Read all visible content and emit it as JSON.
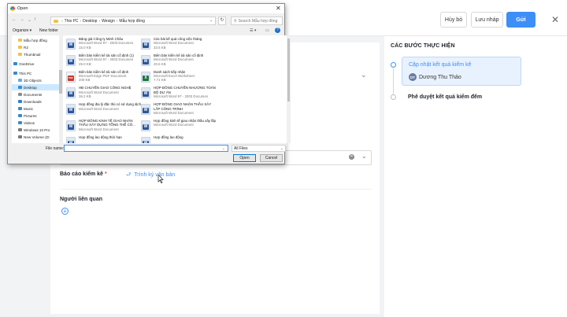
{
  "header": {
    "cancel_label": "Hủy bỏ",
    "draft_label": "Lưu nháp",
    "send_label": "Gửi"
  },
  "form": {
    "report_label": "Báo cáo kiểm kê",
    "report_action": "Trình ký văn bản",
    "related_label": "Người liên quan",
    "add_symbol": "+"
  },
  "steps": {
    "title": "CÁC BƯỚC THỰC HIỆN",
    "items": [
      {
        "title": "Cập nhật kết quả kiểm kê",
        "assignee_initials": "DT",
        "assignee": "Dương Thu Thảo",
        "active": true
      },
      {
        "title": "Phê duyệt kết quả kiểm đếm",
        "active": false
      }
    ]
  },
  "dialog": {
    "title": "Open",
    "breadcrumb": [
      "This PC",
      "Desktop",
      "Wesign",
      "Mẫu hợp đồng"
    ],
    "search_placeholder": "Search Mẫu hợp đồng",
    "toolbar": {
      "organize": "Organize ▾",
      "new_folder": "New folder"
    },
    "nav_items": [
      {
        "label": "Mẫu hợp đồng",
        "icon": "folder-icon",
        "color": "#f1c24b"
      },
      {
        "label": "R2",
        "icon": "folder-icon",
        "color": "#f1c24b"
      },
      {
        "label": "Thumbnail",
        "icon": "folder-icon",
        "color": "#f1c24b"
      },
      {
        "label": "OneDrive",
        "icon": "cloud-icon",
        "color": "#2b88d8"
      },
      {
        "label": "This PC",
        "icon": "computer-icon",
        "color": "#3a8ad1"
      },
      {
        "label": "3D Objects",
        "icon": "cube-icon",
        "color": "#6aa7e0"
      },
      {
        "label": "Desktop",
        "icon": "desktop-icon",
        "color": "#3a8ad1"
      },
      {
        "label": "Documents",
        "icon": "document-icon",
        "color": "#8c8c8c"
      },
      {
        "label": "Downloads",
        "icon": "download-icon",
        "color": "#2d7fd3"
      },
      {
        "label": "Music",
        "icon": "music-icon",
        "color": "#3a8ad1"
      },
      {
        "label": "Pictures",
        "icon": "picture-icon",
        "color": "#3a8ad1"
      },
      {
        "label": "Videos",
        "icon": "video-icon",
        "color": "#3a8ad1"
      },
      {
        "label": "Windows 10 Pro",
        "icon": "drive-icon",
        "color": "#7a7a7a"
      },
      {
        "label": "New Volume (D:",
        "icon": "drive-icon",
        "color": "#7a7a7a"
      }
    ],
    "files": [
      {
        "name": "Bảng giá Công ty Minh Châu",
        "type": "Microsoft Word 97 - 2003 Documen",
        "size": "15.0 KB",
        "icon": "W"
      },
      {
        "name": "Các bài kế quả công việc tháng",
        "type": "Microsoft Word Document",
        "size": "33.6 KB",
        "icon": "W"
      },
      {
        "name": "Biên bản kiểm kê tài sản cố định (1)",
        "type": "Microsoft Word 97 - 2003 Documen",
        "size": "25.0 KB",
        "icon": "W"
      },
      {
        "name": "Biên bản kiểm kê tài sản cố định",
        "type": "Microsoft Word Document",
        "size": "20.6 KB",
        "icon": "W"
      },
      {
        "name": "Biên bản kiểm kê tài sản cố định",
        "type": "Microsoft Edge PDF Document",
        "size": "200 KB",
        "icon": "PDF"
      },
      {
        "name": "Danh sách tiếp nhận",
        "type": "Microsoft Excel Worksheet",
        "size": "7.71 KB",
        "icon": "X"
      },
      {
        "name": "HĐ CHUYỂN GIAO CÔNG NGHỆ",
        "type": "Microsoft Word Document",
        "size": "36.2 KB",
        "icon": "W"
      },
      {
        "name": "HỢP ĐỒNG CHUYỂN NHƯỢNG TOÀN BỘ DỰ ÁN",
        "type": "Microsoft Word 97 - 2003 Documen",
        "size": "",
        "icon": "W"
      },
      {
        "name": "Hợp đồng đại lý đặc thù có sử dụng dịch",
        "type": "Microsoft Word Document",
        "size": "",
        "icon": "W"
      },
      {
        "name": "HỢP ĐỒNG GIAO NHẬN THẦU XÂY LẮP CÔNG TRÌNH",
        "type": "Microsoft Word Document",
        "size": "",
        "icon": "W"
      },
      {
        "name": "HỢP ĐỒNG KINH TẾ GIAO NHẬN THẦU XÂY DỰNG TỔNG THỂ CÔ...",
        "type": "Microsoft Word Document",
        "size": "",
        "icon": "W"
      },
      {
        "name": "Hợp đồng kinh tế giao nhận thầu xây lắp",
        "type": "Microsoft Word Document",
        "size": "",
        "icon": "W"
      },
      {
        "name": "Hợp đồng lao động thời hạn",
        "type": "",
        "size": "",
        "icon": "W"
      },
      {
        "name": "Hợp đồng lao động",
        "type": "",
        "size": "",
        "icon": "W"
      }
    ],
    "filename_label": "File name:",
    "filename_value": "",
    "filter_value": "All Files",
    "open_label": "Open",
    "cancel_label": "Cancel"
  },
  "colors": {
    "accent": "#3e8ef7",
    "word": "#2b579a",
    "excel": "#217346",
    "pdf": "#c73b2f"
  }
}
